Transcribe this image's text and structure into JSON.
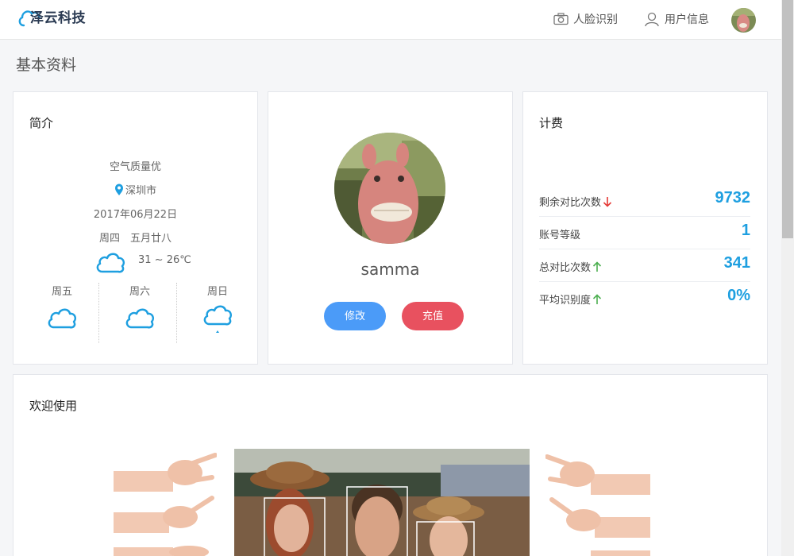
{
  "app": {
    "logo_text": "泽云科技"
  },
  "nav": {
    "face_recognition": "人脸识别",
    "user_info": "用户信息"
  },
  "page": {
    "title": "基本资料"
  },
  "intro": {
    "title": "简介",
    "air_quality": "空气质量优",
    "city": "深圳市",
    "date": "2017年06月22日",
    "weekday_lunar": "周四　五月廿八",
    "temperature": "31 ~ 26℃",
    "weather_icon": "cloud-icon",
    "forecast": [
      {
        "day": "周五",
        "icon": "cloud-icon"
      },
      {
        "day": "周六",
        "icon": "cloud-icon"
      },
      {
        "day": "周日",
        "icon": "rain-cloud-icon"
      }
    ]
  },
  "profile": {
    "username": "samma",
    "edit_label": "修改",
    "recharge_label": "充值",
    "edit_color": "#4b9bf8",
    "recharge_color": "#e8515f"
  },
  "billing": {
    "title": "计费",
    "rows": [
      {
        "label": "剩余对比次数",
        "value": "9732",
        "trend": "down"
      },
      {
        "label": "账号等级",
        "value": "1",
        "trend": "none"
      },
      {
        "label": "总对比次数",
        "value": "341",
        "trend": "up"
      },
      {
        "label": "平均识别度",
        "value": "0%",
        "trend": "up"
      }
    ]
  },
  "welcome": {
    "title": "欢迎使用"
  },
  "colors": {
    "accent": "#1e9fe0",
    "up": "#4caf50",
    "down": "#e53935"
  }
}
